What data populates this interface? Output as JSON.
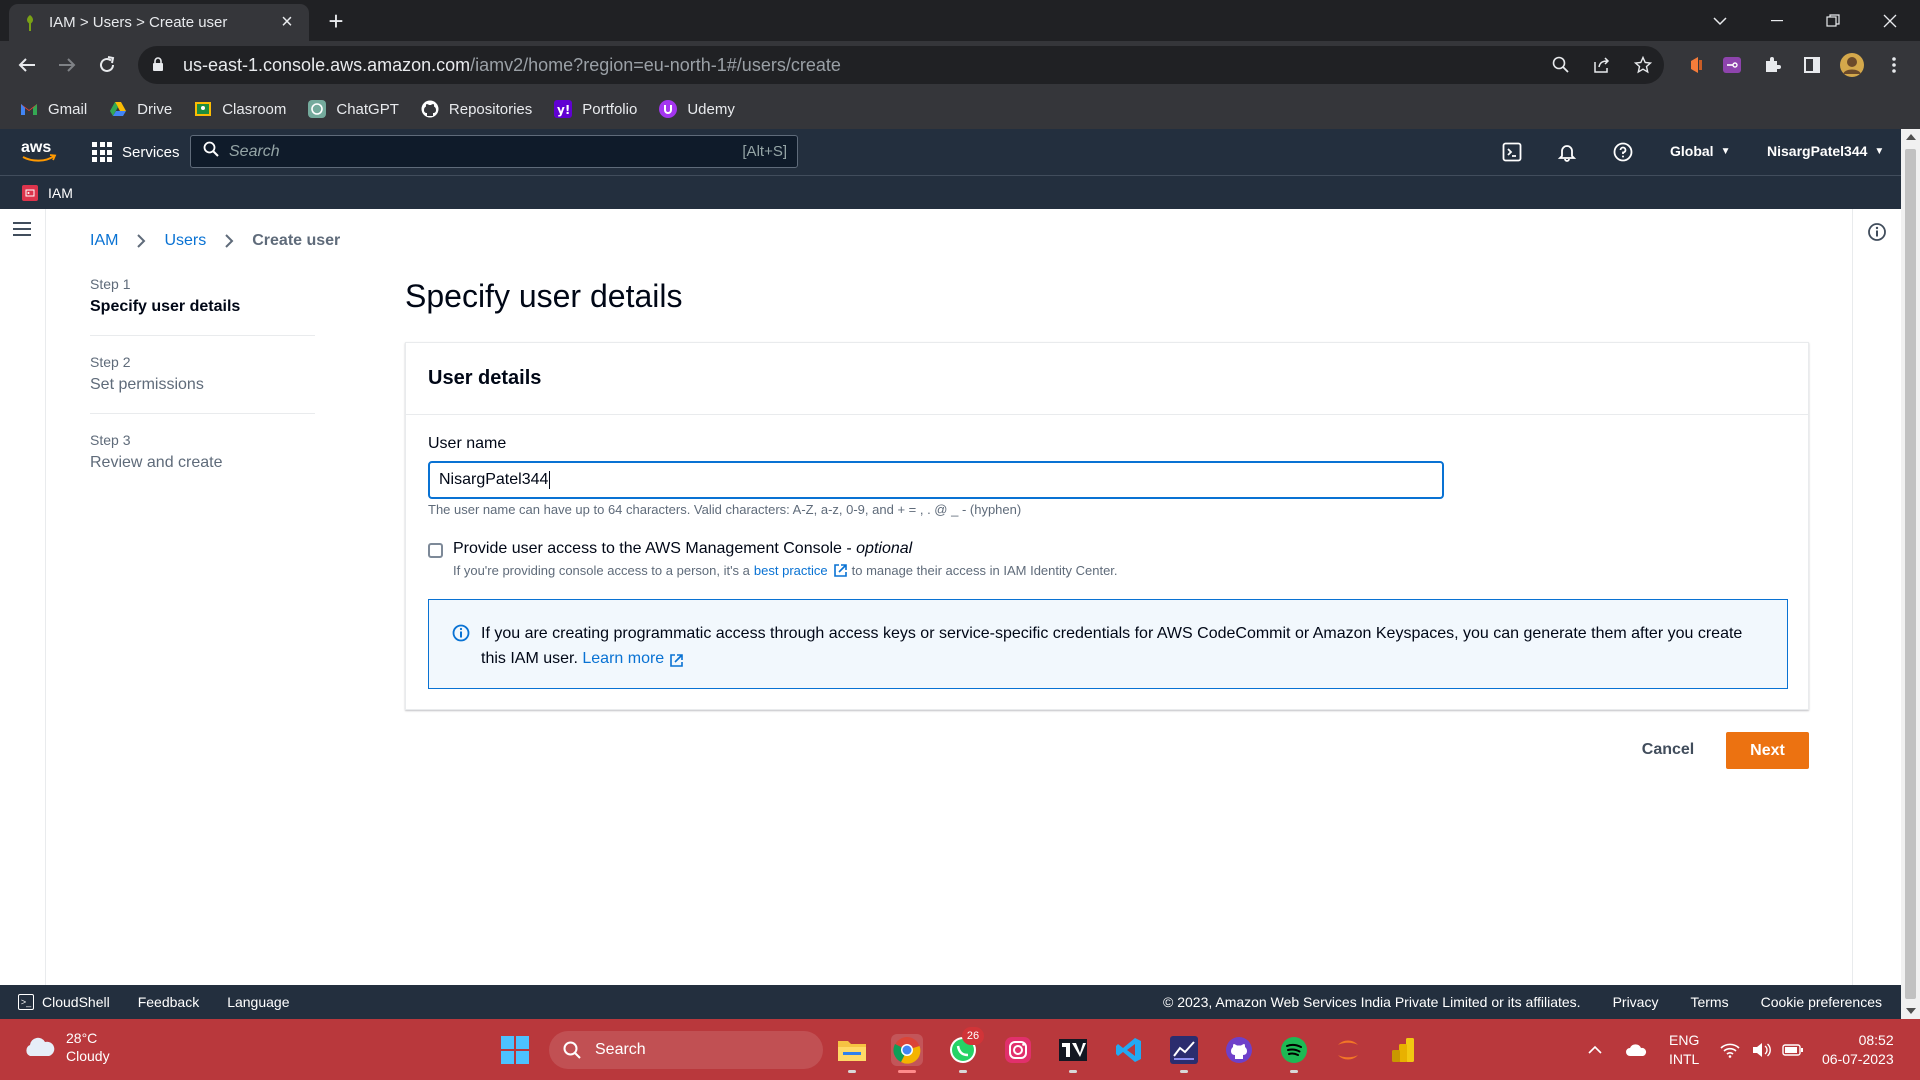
{
  "browser": {
    "tab_title": "IAM > Users > Create user",
    "url_host": "us-east-1.console.aws.amazon.com",
    "url_path": "/iamv2/home?region=eu-north-1#/users/create",
    "bookmarks": [
      {
        "label": "Gmail",
        "icon": "gmail-icon"
      },
      {
        "label": "Drive",
        "icon": "drive-icon"
      },
      {
        "label": "Clasroom",
        "icon": "classroom-icon"
      },
      {
        "label": "ChatGPT",
        "icon": "chatgpt-icon"
      },
      {
        "label": "Repositories",
        "icon": "github-icon"
      },
      {
        "label": "Portfolio",
        "icon": "yahoo-icon"
      },
      {
        "label": "Udemy",
        "icon": "udemy-icon"
      }
    ]
  },
  "aws_nav": {
    "logo": "aws",
    "services_label": "Services",
    "search_placeholder": "Search",
    "search_shortcut": "[Alt+S]",
    "region_label": "Global",
    "account_label": "NisargPatel344",
    "service_name": "IAM"
  },
  "breadcrumb": {
    "items": [
      "IAM",
      "Users"
    ],
    "current": "Create user"
  },
  "steps": [
    {
      "num": "Step 1",
      "title": "Specify user details",
      "active": true
    },
    {
      "num": "Step 2",
      "title": "Set permissions",
      "active": false
    },
    {
      "num": "Step 3",
      "title": "Review and create",
      "active": false
    }
  ],
  "page_title": "Specify user details",
  "user_details": {
    "header": "User details",
    "username_label": "User name",
    "username_value": "NisargPatel344",
    "constraint_text": "The user name can have up to 64 characters. Valid characters: A-Z, a-z, 0-9, and + = , . @ _ - (hyphen)",
    "console_access_label": "Provide user access to the AWS Management Console - ",
    "console_access_optional": "optional",
    "console_access_checked": false,
    "desc_prefix": "If you're providing console access to a person, it's a",
    "desc_link": "best practice",
    "desc_suffix": "to manage their access in IAM Identity Center.",
    "alert_text": "If you are creating programmatic access through access keys or service-specific credentials for AWS CodeCommit or Amazon Keyspaces, you can generate them after you create this IAM user.",
    "alert_link": "Learn more"
  },
  "actions": {
    "cancel": "Cancel",
    "next": "Next"
  },
  "footer": {
    "cloudshell": "CloudShell",
    "feedback": "Feedback",
    "language": "Language",
    "copyright": "© 2023, Amazon Web Services India Private Limited or its affiliates.",
    "privacy": "Privacy",
    "terms": "Terms",
    "cookies": "Cookie preferences"
  },
  "taskbar": {
    "temperature": "28°C",
    "weather": "Cloudy",
    "search_label": "Search",
    "whatsapp_badge": "26",
    "lang_top": "ENG",
    "lang_bottom": "INTL",
    "time": "08:52",
    "date": "06-07-2023"
  },
  "colors": {
    "aws_nav": "#232f3e",
    "link": "#0972d3",
    "primary_button": "#ec7211",
    "taskbar": "#b9383c"
  }
}
